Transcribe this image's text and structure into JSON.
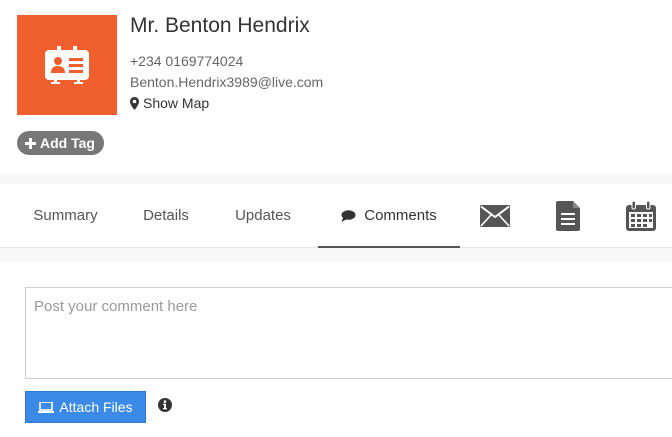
{
  "contact": {
    "name": "Mr. Benton Hendrix",
    "phone": "+234 0169774024",
    "email": "Benton.Hendrix3989@live.com",
    "map_label": "Show Map",
    "add_tag_label": "Add Tag",
    "avatar_color": "#f0602e",
    "avatar_icon": "contact-card-icon"
  },
  "tabs": {
    "items": [
      {
        "label": "Summary"
      },
      {
        "label": "Details"
      },
      {
        "label": "Updates"
      },
      {
        "label": "Comments",
        "active": true
      }
    ],
    "icon_tabs": [
      "envelope-icon",
      "document-icon",
      "calendar-icon"
    ]
  },
  "comment": {
    "placeholder": "Post your comment here",
    "attach_label": "Attach Files",
    "attach_color": "#3c8ae8"
  }
}
